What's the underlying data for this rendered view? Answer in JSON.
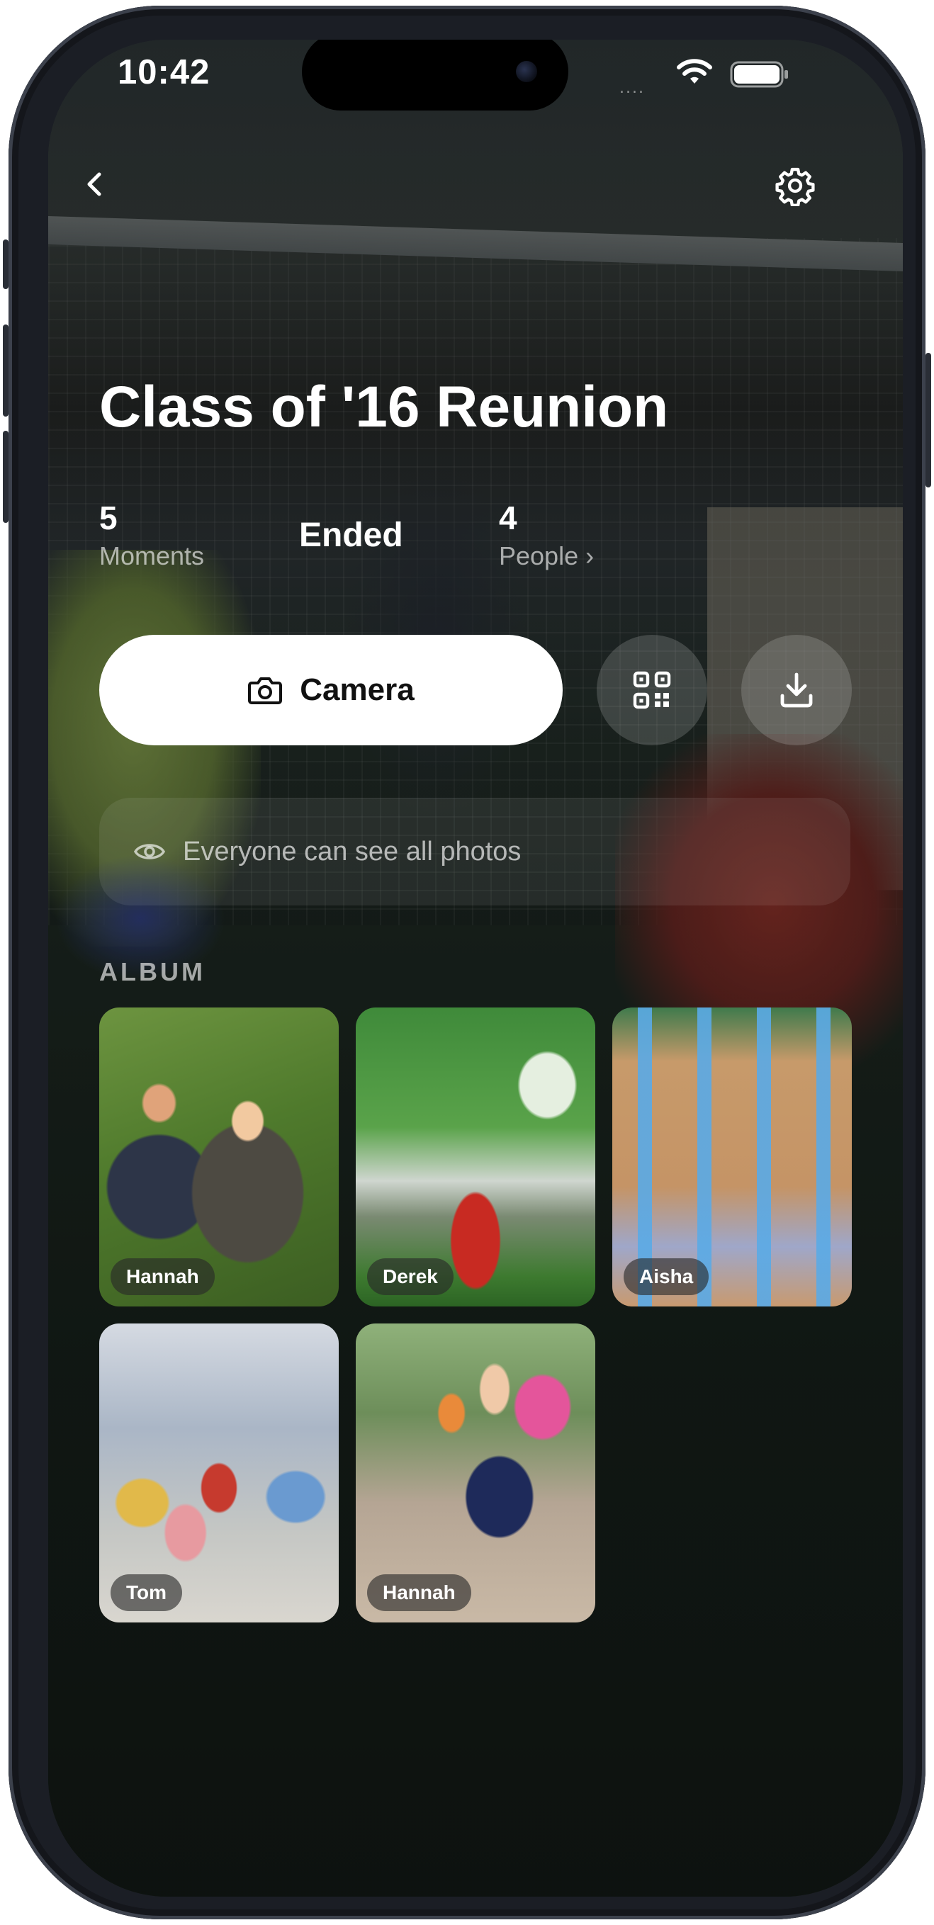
{
  "status_bar": {
    "time": "10:42",
    "signal_dots": "....",
    "wifi_icon": "wifi-icon",
    "battery_icon": "battery-icon"
  },
  "header": {
    "back_icon": "chevron-left-icon",
    "settings_icon": "gear-icon"
  },
  "event": {
    "title": "Class of '16 Reunion"
  },
  "stats": {
    "moments_count": "5",
    "moments_label": "Moments",
    "status": "Ended",
    "people_count": "4",
    "people_label": "People ›"
  },
  "actions": {
    "camera_label": "Camera",
    "camera_icon": "camera-icon",
    "qr_icon": "qr-code-icon",
    "download_icon": "download-icon"
  },
  "visibility": {
    "icon": "eye-icon",
    "text": "Everyone can see all photos"
  },
  "album": {
    "heading": "ALBUM",
    "photos": [
      {
        "author": "Hannah"
      },
      {
        "author": "Derek"
      },
      {
        "author": "Aisha"
      },
      {
        "author": "Tom"
      },
      {
        "author": "Hannah"
      }
    ]
  },
  "colors": {
    "camera_button_bg": "#ffffff",
    "text_primary": "#ffffff",
    "text_secondary": "#a6a8a7"
  }
}
